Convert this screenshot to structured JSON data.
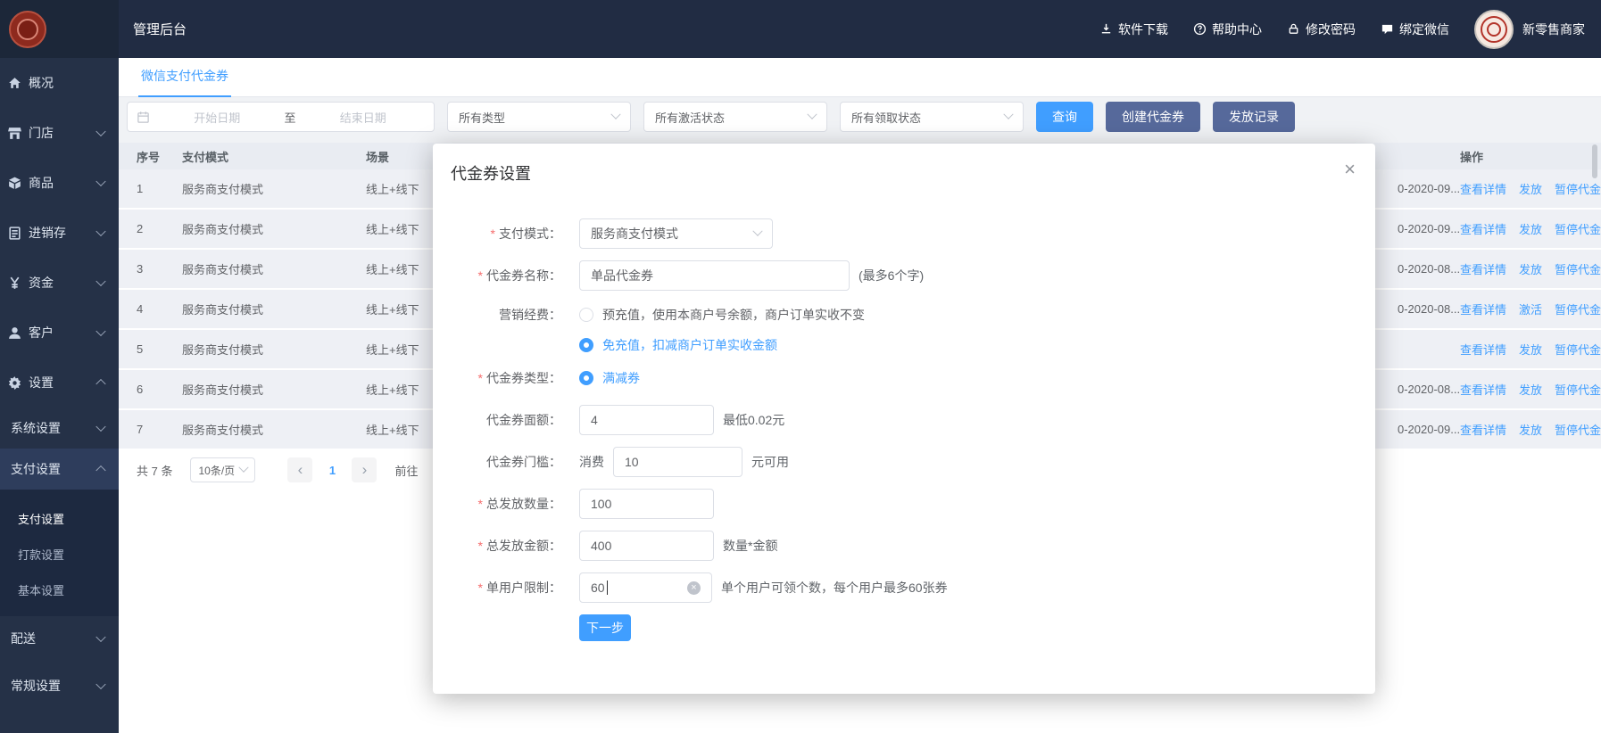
{
  "colors": {
    "accent": "#409eff",
    "header_bg": "#212c43",
    "sidebar_bg": "#253147",
    "submenu_bg": "#1d2940",
    "secondary_button": "#56699b",
    "required_mark": "#f56c6c",
    "logo_seal": "#8e2a1e"
  },
  "header": {
    "brand": "管理后台",
    "items": [
      {
        "label": "软件下载"
      },
      {
        "label": "帮助中心"
      },
      {
        "label": "修改密码"
      },
      {
        "label": "绑定微信"
      }
    ],
    "user": "新零售商家"
  },
  "sidebar": {
    "items": [
      {
        "label": "概况"
      },
      {
        "label": "门店"
      },
      {
        "label": "商品"
      },
      {
        "label": "进销存"
      },
      {
        "label": "资金"
      },
      {
        "label": "客户"
      },
      {
        "label": "设置"
      },
      {
        "label": "系统设置"
      },
      {
        "label": "支付设置"
      },
      {
        "label": "支付设置"
      },
      {
        "label": "打款设置"
      },
      {
        "label": "基本设置"
      },
      {
        "label": "配送"
      },
      {
        "label": "常规设置"
      }
    ]
  },
  "tab": {
    "label": "微信支付代金券"
  },
  "filters": {
    "date_start": "开始日期",
    "date_sep": "至",
    "date_end": "结束日期",
    "type": "所有类型",
    "active": "所有激活状态",
    "claim": "所有领取状态",
    "query": "查询",
    "create": "创建代金券",
    "records": "发放记录"
  },
  "table": {
    "headers": {
      "no": "序号",
      "mode": "支付模式",
      "scene": "场景",
      "op": "操作"
    },
    "rows": [
      {
        "no": "1",
        "mode": "服务商支付模式",
        "scene": "线上+线下",
        "date": "0-2020-09...",
        "actions": [
          "查看详情",
          "发放",
          "暂停代金券"
        ]
      },
      {
        "no": "2",
        "mode": "服务商支付模式",
        "scene": "线上+线下",
        "date": "0-2020-09...",
        "actions": [
          "查看详情",
          "发放",
          "暂停代金券"
        ]
      },
      {
        "no": "3",
        "mode": "服务商支付模式",
        "scene": "线上+线下",
        "date": "0-2020-08...",
        "actions": [
          "查看详情",
          "发放",
          "暂停代金券"
        ]
      },
      {
        "no": "4",
        "mode": "服务商支付模式",
        "scene": "线上+线下",
        "date": "0-2020-08...",
        "actions": [
          "查看详情",
          "激活",
          "暂停代金券"
        ]
      },
      {
        "no": "5",
        "mode": "服务商支付模式",
        "scene": "线上+线下",
        "date": "",
        "actions": [
          "查看详情",
          "发放",
          "暂停代金券"
        ]
      },
      {
        "no": "6",
        "mode": "服务商支付模式",
        "scene": "线上+线下",
        "date": "0-2020-08...",
        "actions": [
          "查看详情",
          "发放",
          "暂停代金券"
        ]
      },
      {
        "no": "7",
        "mode": "服务商支付模式",
        "scene": "线上+线下",
        "date": "0-2020-09...",
        "actions": [
          "查看详情",
          "发放",
          "暂停代金券"
        ]
      }
    ]
  },
  "pagination": {
    "total": "共 7 条",
    "page_size": "10条/页",
    "prev": "‹",
    "page": "1",
    "next": "›",
    "goto": "前往"
  },
  "modal": {
    "title": "代金券设置",
    "close": "×",
    "pay_mode": {
      "label": "支付模式：",
      "value": "服务商支付模式"
    },
    "name": {
      "label": "代金券名称：",
      "value": "单品代金券",
      "hint": "(最多6个字)"
    },
    "budget": {
      "label": "营销经费：",
      "option1": "预充值，使用本商户号余额，商户订单实收不变",
      "option2": "免充值，扣减商户订单实收金额"
    },
    "type": {
      "label": "代金券类型：",
      "option": "满减券"
    },
    "amount": {
      "label": "代金券面额：",
      "value": "4",
      "hint": "最低0.02元"
    },
    "threshold": {
      "label": "代金券门槛：",
      "prefix": "消费",
      "value": "10",
      "suffix": "元可用"
    },
    "count": {
      "label": "总发放数量：",
      "value": "100"
    },
    "total": {
      "label": "总发放金额：",
      "value": "400",
      "hint": "数量*金额"
    },
    "limit": {
      "label": "单用户限制：",
      "value": "60",
      "hint": "单个用户可领个数，每个用户最多60张券"
    },
    "next": "下一步"
  }
}
